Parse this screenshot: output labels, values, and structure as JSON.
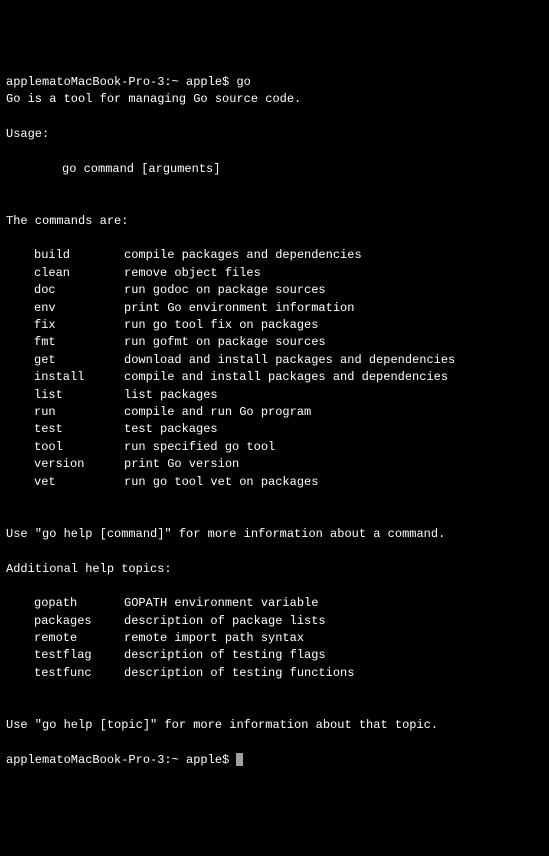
{
  "prompt1": "applematoMacBook-Pro-3:~ apple$ ",
  "cmd1": "go",
  "intro": "Go is a tool for managing Go source code.",
  "usage_label": "Usage:",
  "usage_syntax": "go command [arguments]",
  "commands_header": "The commands are:",
  "commands": [
    {
      "name": "build",
      "desc": "compile packages and dependencies"
    },
    {
      "name": "clean",
      "desc": "remove object files"
    },
    {
      "name": "doc",
      "desc": "run godoc on package sources"
    },
    {
      "name": "env",
      "desc": "print Go environment information"
    },
    {
      "name": "fix",
      "desc": "run go tool fix on packages"
    },
    {
      "name": "fmt",
      "desc": "run gofmt on package sources"
    },
    {
      "name": "get",
      "desc": "download and install packages and dependencies"
    },
    {
      "name": "install",
      "desc": "compile and install packages and dependencies"
    },
    {
      "name": "list",
      "desc": "list packages"
    },
    {
      "name": "run",
      "desc": "compile and run Go program"
    },
    {
      "name": "test",
      "desc": "test packages"
    },
    {
      "name": "tool",
      "desc": "run specified go tool"
    },
    {
      "name": "version",
      "desc": "print Go version"
    },
    {
      "name": "vet",
      "desc": "run go tool vet on packages"
    }
  ],
  "help_cmd": "Use \"go help [command]\" for more information about a command.",
  "topics_header": "Additional help topics:",
  "topics": [
    {
      "name": "gopath",
      "desc": "GOPATH environment variable"
    },
    {
      "name": "packages",
      "desc": "description of package lists"
    },
    {
      "name": "remote",
      "desc": "remote import path syntax"
    },
    {
      "name": "testflag",
      "desc": "description of testing flags"
    },
    {
      "name": "testfunc",
      "desc": "description of testing functions"
    }
  ],
  "help_topic": "Use \"go help [topic]\" for more information about that topic.",
  "prompt2": "applematoMacBook-Pro-3:~ apple$ "
}
